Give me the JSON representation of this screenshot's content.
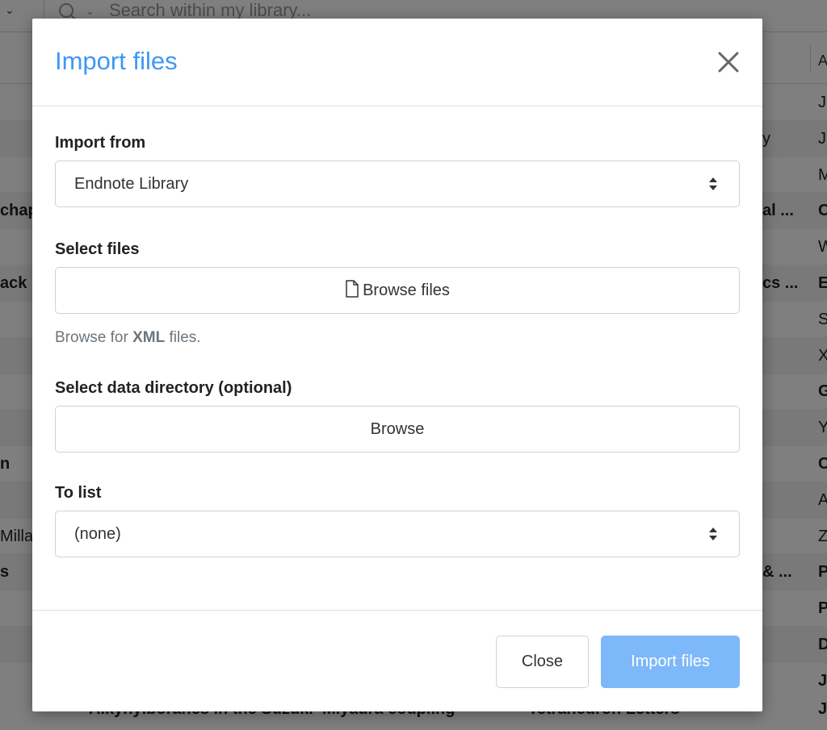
{
  "background": {
    "search_placeholder": "Search within my library...",
    "header_col_label": "A",
    "rows": [
      {
        "left": "",
        "mid": "",
        "right": "J",
        "bold": false,
        "striped": false
      },
      {
        "left": "",
        "mid": "y",
        "right": "J",
        "bold": false,
        "striped": true
      },
      {
        "left": "",
        "mid": "",
        "right": "M",
        "bold": false,
        "striped": false
      },
      {
        "left": "chap",
        "mid": "al ...",
        "right": "C",
        "bold": true,
        "striped": true
      },
      {
        "left": "",
        "mid": "",
        "right": "W",
        "bold": false,
        "striped": false
      },
      {
        "left": "ack",
        "mid": "cs ...",
        "right": "E",
        "bold": true,
        "striped": true
      },
      {
        "left": "",
        "mid": "",
        "right": "S",
        "bold": false,
        "striped": false
      },
      {
        "left": "",
        "mid": "",
        "right": "X",
        "bold": false,
        "striped": true
      },
      {
        "left": "",
        "mid": "",
        "right": "G",
        "bold": true,
        "striped": false
      },
      {
        "left": "",
        "mid": "",
        "right": "Y",
        "bold": false,
        "striped": true
      },
      {
        "left": "n",
        "mid": "",
        "right": "C",
        "bold": true,
        "striped": false
      },
      {
        "left": "",
        "mid": "",
        "right": "A",
        "bold": false,
        "striped": true
      },
      {
        "left": "Milla",
        "mid": "",
        "right": "Z",
        "bold": false,
        "striped": false
      },
      {
        "left": "s",
        "mid": "& ...",
        "right": "P",
        "bold": true,
        "striped": true
      },
      {
        "left": "",
        "mid": "",
        "right": "P",
        "bold": true,
        "striped": false
      },
      {
        "left": "",
        "mid": "",
        "right": "D",
        "bold": true,
        "striped": true
      },
      {
        "left": "",
        "mid": "",
        "right": "J",
        "bold": true,
        "striped": false
      }
    ],
    "last_row_title": "Alkynylboranes in the Suzuki–Miyaura coupling",
    "last_row_journal": "Tetrahedron Letters"
  },
  "modal": {
    "title": "Import files",
    "import_from": {
      "label": "Import from",
      "value": "Endnote Library"
    },
    "select_files": {
      "label": "Select files",
      "button_label": "Browse files",
      "help_prefix": "Browse for ",
      "help_bold": "XML",
      "help_suffix": " files."
    },
    "data_directory": {
      "label": "Select data directory (optional)",
      "button_label": "Browse"
    },
    "to_list": {
      "label": "To list",
      "value": "(none)"
    },
    "footer": {
      "close_label": "Close",
      "import_label": "Import files"
    }
  },
  "colors": {
    "title": "#3d98f5",
    "primary_button": "#7db8fa",
    "overlay": "rgba(0,0,0,0.5)"
  }
}
